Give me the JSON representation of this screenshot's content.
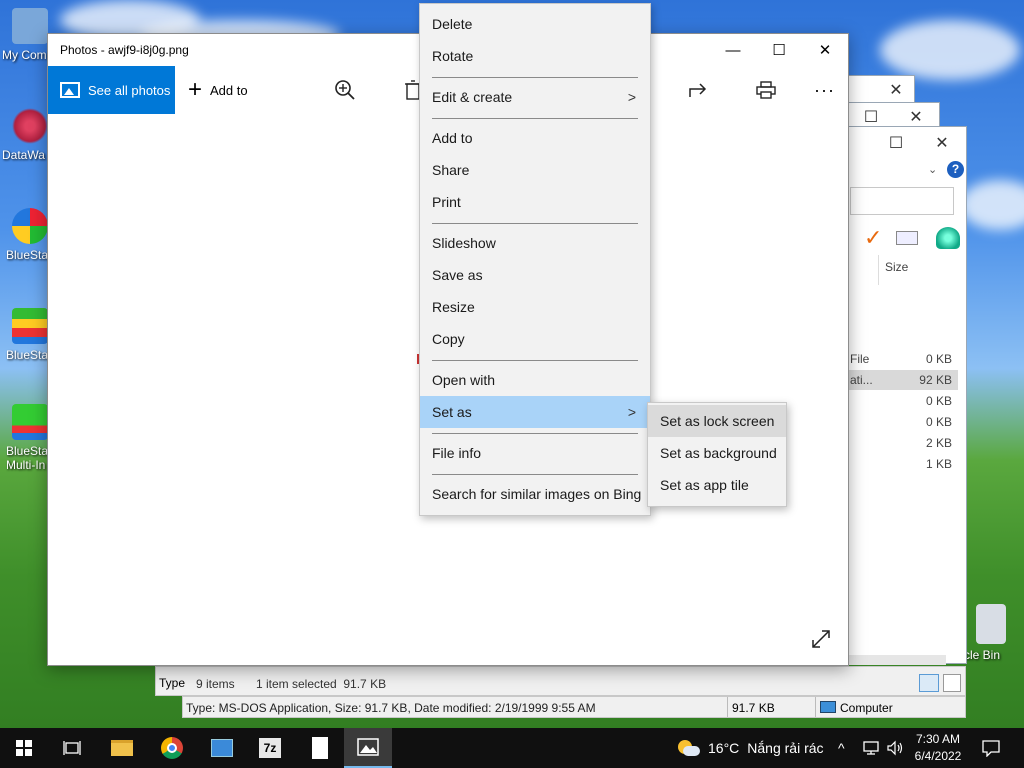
{
  "desktop": {
    "icons": [
      {
        "label": "My Com"
      },
      {
        "label": "DataWa"
      },
      {
        "label": "BlueSta"
      },
      {
        "label": "BlueSta"
      },
      {
        "label": "BlueSta"
      },
      {
        "label": "Multi-In"
      },
      {
        "label": "ycle Bin"
      }
    ]
  },
  "photos": {
    "title": "Photos - awjf9-i8j0g.png",
    "see_all": "See all photos",
    "add_to": "Add to"
  },
  "context_menu": {
    "items": [
      "Delete",
      "Rotate",
      "Edit & create",
      "Add to",
      "Share",
      "Print",
      "Slideshow",
      "Save as",
      "Resize",
      "Copy",
      "Open with",
      "Set as",
      "File info",
      "Search for similar images on Bing"
    ]
  },
  "submenu": {
    "items": [
      "Set as lock screen",
      "Set as background",
      "Set as app tile"
    ]
  },
  "explorer": {
    "size_header": "Size",
    "rows": [
      {
        "name": "File",
        "size": "0 KB"
      },
      {
        "name": "ati...",
        "size": "92 KB"
      },
      {
        "name": "",
        "size": "0 KB"
      },
      {
        "name": "",
        "size": "0 KB"
      },
      {
        "name": "",
        "size": "2 KB"
      },
      {
        "name": "",
        "size": "1 KB"
      }
    ],
    "status_left": "9 items",
    "status_selected": "1 item selected  91.7 KB",
    "type_label": "Type",
    "details": "Type: MS-DOS Application, Size: 91.7 KB, Date modified: 2/19/1999 9:55 AM",
    "details_size": "91.7 KB",
    "details_location": "Computer"
  },
  "taskbar": {
    "weather_temp": "16°C",
    "weather_text": "Nắng rải rác",
    "time": "7:30 AM",
    "date": "6/4/2022"
  }
}
